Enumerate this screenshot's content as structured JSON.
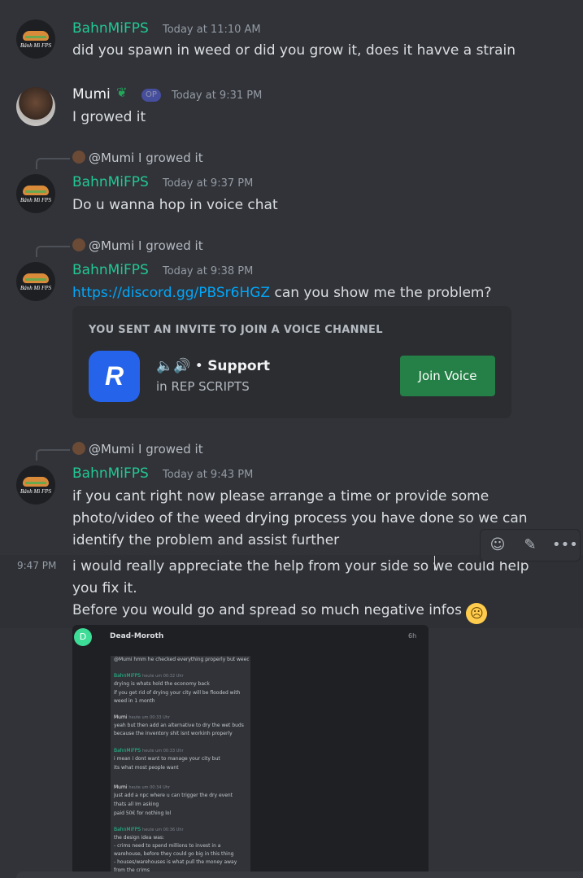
{
  "messages": {
    "m1": {
      "author": "BahnMiFPS",
      "time": "Today at 11:10 AM",
      "text": "did you spawn in weed or did you grow it, does it havve a strain",
      "avatar_text": "Bánh Mì FPS"
    },
    "m2": {
      "author": "Mumi",
      "badge": "OP",
      "time": "Today at 9:31 PM",
      "text": "I growed it"
    },
    "m3": {
      "reply_mention": "@Mumi",
      "reply_text": "I growed it",
      "author": "BahnMiFPS",
      "time": "Today at 9:37 PM",
      "text": "Do u wanna hop in voice chat"
    },
    "m4": {
      "reply_mention": "@Mumi",
      "reply_text": "I growed it",
      "author": "BahnMiFPS",
      "time": "Today at 9:38 PM",
      "link": "https://discord.gg/PBSr6HGZ",
      "text": " can you show me the problem?"
    },
    "m5": {
      "reply_mention": "@Mumi",
      "reply_text": "I growed it",
      "author": "BahnMiFPS",
      "time": "Today at 9:43 PM",
      "line1": "if you cant right now please arrange a time or provide some",
      "line2": "photo/video of the weed drying process you have done so we can",
      "line3": "identify the problem and assist further"
    },
    "m6": {
      "side_time": "9:47 PM",
      "line1": "i would really appreciate the help from your side so we could help",
      "line2": "you fix it.",
      "line3": "Before you would go and spread so much negative infos"
    }
  },
  "invite": {
    "title": "YOU SENT AN INVITE TO JOIN A VOICE CHANNEL",
    "channel_prefix": " • ",
    "channel": "Support",
    "server": "in REP SCRIPTS",
    "button": "Join Voice",
    "logo": "R"
  },
  "attachment": {
    "avatar_letter": "D",
    "user": "Dead-Moroth",
    "time": "6h",
    "lines": [
      {
        "who": "reply",
        "text": "@Mumi hmm he checked everything properly but weed drying not working, no errors or anything. I know ive read th..."
      },
      {
        "who": "BahnMiFPS",
        "time": "heute um 00:32 Uhr",
        "text": "drying is whats hold the economy back"
      },
      {
        "who": "",
        "text": "if you get rid of drying your city will be flooded with"
      },
      {
        "who": "",
        "text": "weed in 1 month"
      },
      {
        "who": "Mumi",
        "time": "heute um 00:33 Uhr",
        "text": "yeah but then add an alternative to dry the wet buds"
      },
      {
        "who": "",
        "text": "because the inventory shit isnt workinh properly"
      },
      {
        "who": "BahnMiFPS",
        "time": "heute um 00:33 Uhr",
        "text": "i mean i dont want to manage your city but"
      },
      {
        "who": "",
        "text": "its what most people want"
      },
      {
        "who": "Mumi",
        "time": "heute um 00:34 Uhr",
        "text": "Just add a npc where u can trigger the dry event"
      },
      {
        "who": "",
        "text": "thats all Im asking"
      },
      {
        "who": "",
        "text": "paid 50€ for nothing lol"
      },
      {
        "who": "BahnMiFPS",
        "time": "heute um 00:36 Uhr",
        "text": "the design idea was:"
      },
      {
        "who": "",
        "text": "- crims need to spend millions to invest in a"
      },
      {
        "who": "",
        "text": "warehouse, before they could go big in this thing"
      },
      {
        "who": "",
        "text": "- houses/warehouses is what pull the money away"
      },
      {
        "who": "",
        "text": "from the crims"
      }
    ]
  },
  "icons": {
    "add_reaction": "add-reaction-icon",
    "edit": "pencil-icon",
    "more": "more-icon",
    "speaker": "speaker-icon",
    "sprout": "sprout-icon",
    "sad": "frowning-face-icon"
  },
  "colors": {
    "background": "#313338",
    "username": "#23c793",
    "link": "#00a8fc",
    "join_button": "#248046",
    "op_badge": "#5865f2"
  }
}
